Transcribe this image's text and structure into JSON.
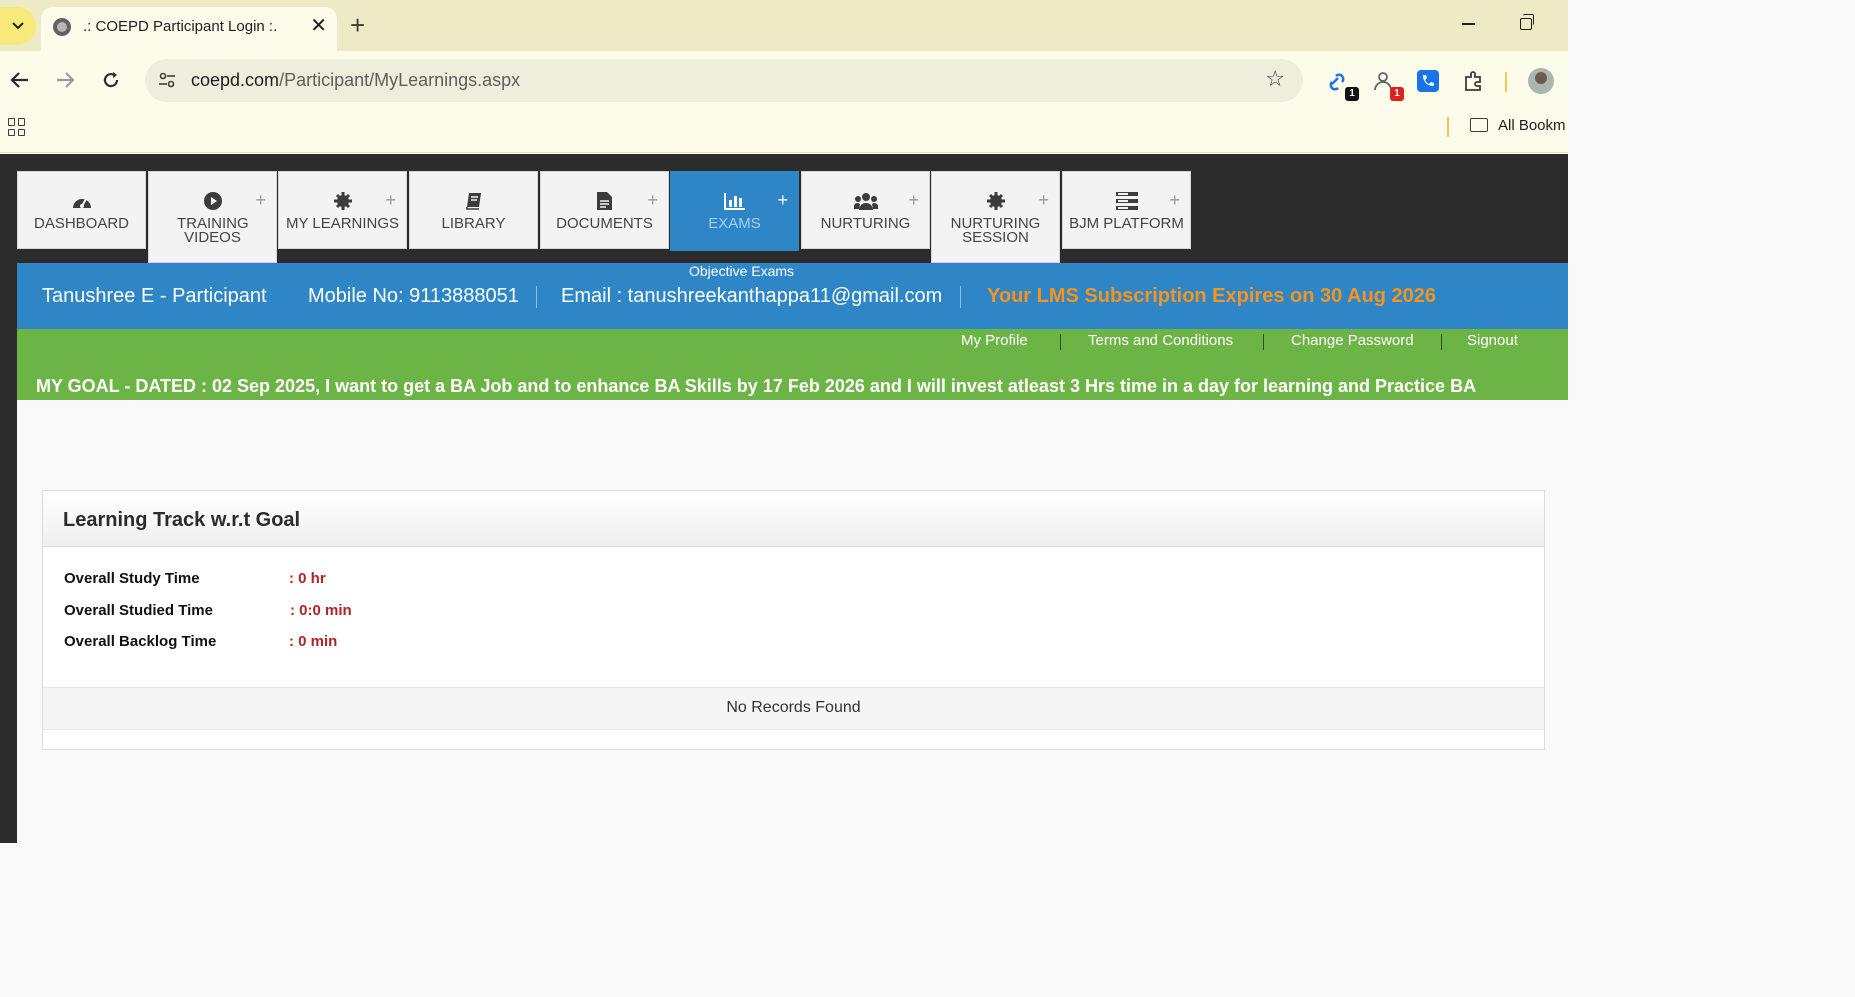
{
  "browser": {
    "tab_title": ".: COEPD Participant Login :.",
    "url_host": "coepd.com",
    "url_path": "/Participant/MyLearnings.aspx",
    "bookmarks_label": "All Bookm",
    "extensions": [
      {
        "icon": "linked-extension-icon",
        "badge": "1",
        "badge_color": "#111111"
      },
      {
        "icon": "people-extension-icon",
        "badge": "1",
        "badge_color": "#e02020"
      },
      {
        "icon": "phone-extension-icon",
        "badge": ""
      },
      {
        "icon": "puzzle-icon",
        "badge": ""
      }
    ]
  },
  "nav": {
    "tabs": [
      {
        "label": "DASHBOARD",
        "icon": "dashboard-icon",
        "plus": false,
        "active": false
      },
      {
        "label": "TRAINING VIDEOS",
        "icon": "play-icon",
        "plus": true,
        "active": false
      },
      {
        "label": "MY LEARNINGS",
        "icon": "gear-icon",
        "plus": true,
        "active": false
      },
      {
        "label": "LIBRARY",
        "icon": "book-icon",
        "plus": false,
        "active": false
      },
      {
        "label": "DOCUMENTS",
        "icon": "document-icon",
        "plus": true,
        "active": false
      },
      {
        "label": "EXAMS",
        "icon": "bar-chart-icon",
        "plus": true,
        "active": true
      },
      {
        "label": "NURTURING",
        "icon": "users-icon",
        "plus": true,
        "active": false
      },
      {
        "label": "NURTURING SESSION",
        "icon": "gear-icon",
        "plus": true,
        "active": false
      },
      {
        "label": "BJM PLATFORM",
        "icon": "server-icon",
        "plus": true,
        "active": false
      }
    ],
    "active_submenu": "Objective Exams"
  },
  "user": {
    "name": "Tanushree E - Participant",
    "mobile": "Mobile No: 9113888051",
    "email": "Email : tanushreekanthappa11@gmail.com",
    "expiry": "Your LMS Subscription Expires on 30 Aug 2026"
  },
  "links": [
    "My Profile",
    "Terms and Conditions",
    "Change Password",
    "Signout"
  ],
  "goal": "MY GOAL - DATED : 02 Sep 2025, I want to get a BA Job and to enhance BA Skills by 17 Feb 2026 and I will invest atleast 3 Hrs time in a day for learning and Practice BA",
  "track": {
    "title": "Learning Track w.r.t Goal",
    "stats": [
      {
        "label": "Overall Study Time",
        "value": ": 0 hr"
      },
      {
        "label": "Overall Studied Time",
        "value": ": 0:0 min"
      },
      {
        "label": "Overall Backlog Time",
        "value": ": 0 min"
      }
    ],
    "empty_message": "No Records Found"
  },
  "colors": {
    "brand_blue": "#2f86c7",
    "brand_green": "#6db446",
    "expiry_orange": "#f7941d",
    "stat_red": "#b22222"
  }
}
